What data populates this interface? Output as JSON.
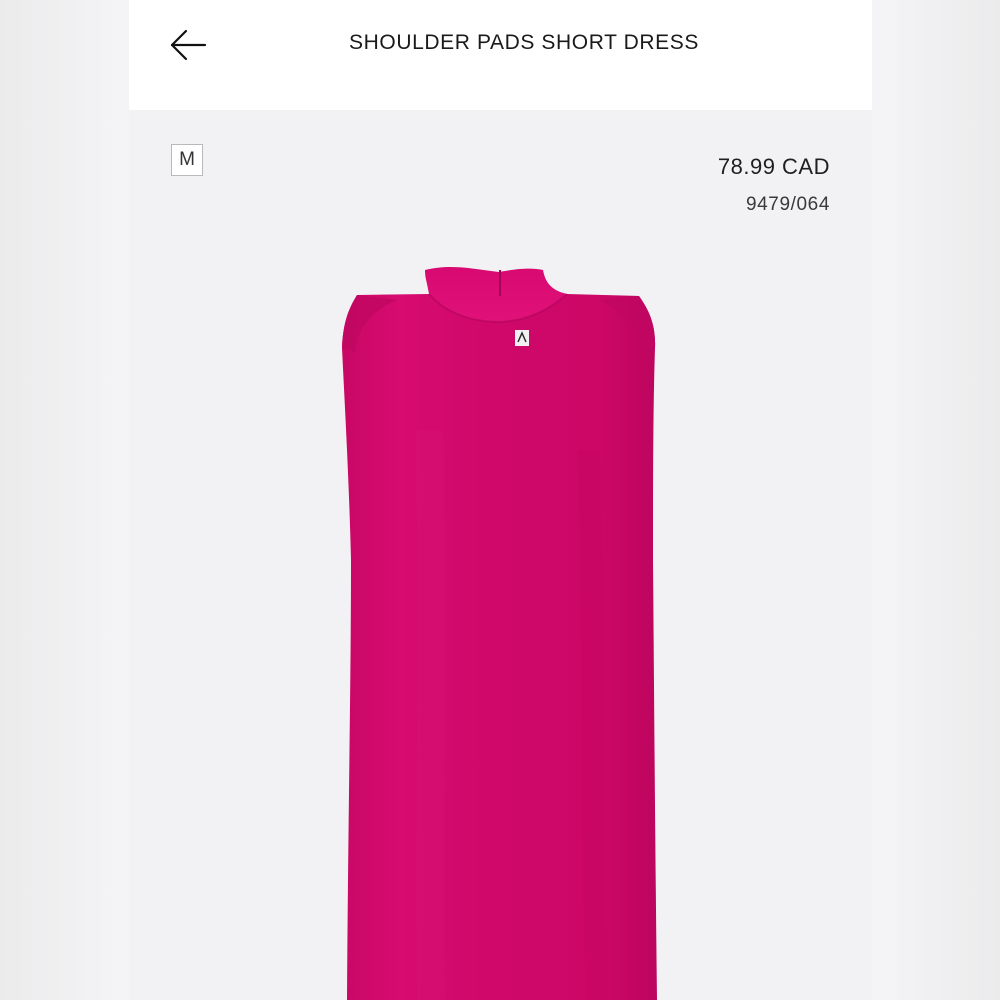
{
  "header": {
    "title": "SHOULDER PADS SHORT DRESS",
    "back_icon": "arrow-left-icon"
  },
  "product": {
    "size": "M",
    "price": "78.99 CAD",
    "reference": "9479/064",
    "color": "#d1086a"
  }
}
